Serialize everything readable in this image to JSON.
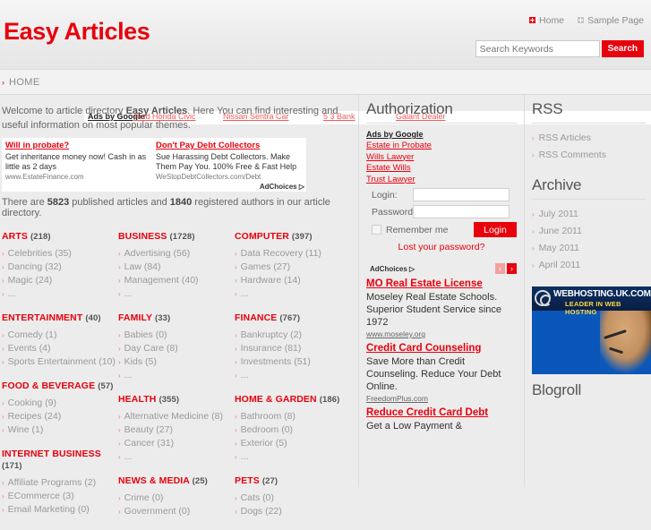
{
  "header": {
    "logo": "Easy Articles",
    "topnav": [
      {
        "label": "Home",
        "icon": "plus-box-icon-red"
      },
      {
        "label": "Sample Page",
        "icon": "plus-box-icon-grey"
      }
    ],
    "search": {
      "placeholder": "Search Keywords",
      "value": "",
      "button_label": "Search"
    }
  },
  "breadcrumb": {
    "arrow": "›",
    "items": [
      "HOME"
    ]
  },
  "ad_strip": {
    "label": "Ads by Google",
    "links": [
      "Find Honda Civic",
      "Nissan Sentra Car",
      "5 3 Bank",
      "Galant Dealer"
    ]
  },
  "main": {
    "intro_part1": "Welcome to article directory ",
    "intro_bold": "Easy Articles",
    "intro_part2": ". Here You can find interesting and useful information on most popular themes.",
    "inline_ads": [
      {
        "title": "Will in probate?",
        "desc": "Get inheritance money now! Cash in as little as 2 days",
        "url": "www.EstateFinance.com"
      },
      {
        "title": "Don't Pay Debt Collectors",
        "desc": "Sue Harassing Debt Collectors. Make Them Pay You. 100% Free & Fast Help",
        "url": "WeStopDebtCollectors.com/Debt"
      }
    ],
    "adchoices_label": "AdChoices ▷",
    "stats": {
      "pre": "There are ",
      "articles": "5823",
      "mid": " published articles and ",
      "authors": "1840",
      "post": " registered authors in our article directory."
    },
    "category_columns": [
      [
        {
          "name": "ARTS",
          "count": "(218)",
          "items": [
            "Celebrities (35)",
            "Dancing (32)",
            "Magic (24)",
            "..."
          ]
        },
        {
          "name": "ENTERTAINMENT",
          "count": "(40)",
          "items": [
            "Comedy (1)",
            "Events (4)",
            "Sports Entertainment (10)"
          ]
        },
        {
          "name": "FOOD & BEVERAGE",
          "count": "(57)",
          "items": [
            "Cooking (9)",
            "Recipes (24)",
            "Wine (1)"
          ]
        },
        {
          "name": "INTERNET BUSINESS",
          "count": "(171)",
          "items": [
            "Affiliate Programs (2)",
            "ECommerce (3)",
            "Email Marketing (0)"
          ]
        }
      ],
      [
        {
          "name": "BUSINESS",
          "count": "(1728)",
          "items": [
            "Advertising (56)",
            "Law (84)",
            "Management (40)",
            "..."
          ]
        },
        {
          "name": "FAMILY",
          "count": "(33)",
          "items": [
            "Babies (0)",
            "Day Care (8)",
            "Kids (5)",
            "..."
          ]
        },
        {
          "name": "HEALTH",
          "count": "(355)",
          "items": [
            "Alternative Medicine (8)",
            "Beauty (27)",
            "Cancer (31)",
            "..."
          ]
        },
        {
          "name": "NEWS & MEDIA",
          "count": "(25)",
          "items": [
            "Crime (0)",
            "Government (0)"
          ]
        }
      ],
      [
        {
          "name": "COMPUTER",
          "count": "(397)",
          "items": [
            "Data Recovery (11)",
            "Games (27)",
            "Hardware (14)",
            "..."
          ]
        },
        {
          "name": "FINANCE",
          "count": "(767)",
          "items": [
            "Bankruptcy (2)",
            "Insurance (81)",
            "Investments (51)",
            "..."
          ]
        },
        {
          "name": "HOME & GARDEN",
          "count": "(186)",
          "items": [
            "Bathroom (8)",
            "Bedroom (0)",
            "Exterior (5)",
            "..."
          ]
        },
        {
          "name": "PETS",
          "count": "(27)",
          "items": [
            "Cats (0)",
            "Dogs (22)"
          ]
        }
      ]
    ]
  },
  "sidebar_mid": {
    "title": "Authorization",
    "google_ads": {
      "label": "Ads by Google",
      "links": [
        "Estate in Probate",
        "Wills Lawyer",
        "Estate Wills",
        "Trust Lawyer"
      ]
    },
    "form": {
      "login_label": "Login:",
      "login_value": "",
      "password_label": "Password:",
      "password_value": "",
      "remember_label": "Remember me",
      "remember_checked": false,
      "submit_label": "Login",
      "lost_password": "Lost your password?"
    },
    "adchoices_label": "AdChoices ▷",
    "arrow_prev": "‹",
    "arrow_next": "›",
    "sponsored": [
      {
        "title": "MO Real Estate License",
        "desc": "Moseley Real Estate Schools. Superior Student Service since 1972",
        "url": "www.moseley.org"
      },
      {
        "title": "Credit Card Counseling",
        "desc": "Save More than Credit Counseling. Reduce Your Debt Online.",
        "url": "FreedomPlus.com"
      },
      {
        "title": "Reduce Credit Card Debt",
        "desc": "Get a Low Payment &",
        "url": ""
      }
    ]
  },
  "sidebar_right": {
    "rss_title": "RSS",
    "rss_items": [
      "RSS Articles",
      "RSS Comments"
    ],
    "archive_title": "Archive",
    "archive_items": [
      "July 2011",
      "June 2011",
      "May 2011",
      "April 2011"
    ],
    "banner": {
      "brand": "WEBHOSTING.UK.COM",
      "tagline": "LEADER IN WEB HOSTING"
    },
    "blogroll_title": "Blogroll"
  },
  "colors": {
    "accent": "#e8000d",
    "text": "#666666",
    "muted": "#9a9a9a",
    "bg": "#ececec"
  }
}
